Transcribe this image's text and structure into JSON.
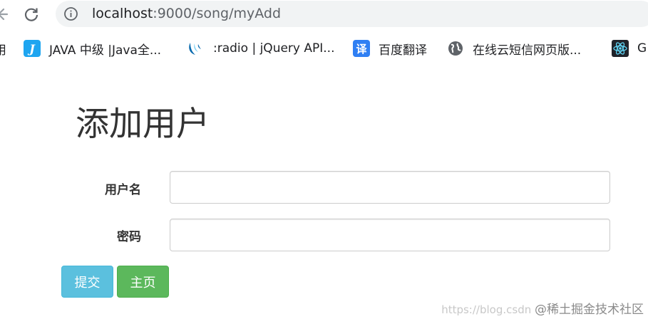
{
  "browser": {
    "url_host": "localhost",
    "url_rest": ":9000/song/myAdd",
    "icons": {
      "back": "back-arrow-icon",
      "reload": "reload-icon",
      "info": "info-icon"
    }
  },
  "bookmarks": {
    "items": [
      {
        "label": "用",
        "icon": "bookmark-icon"
      },
      {
        "label": "JAVA 中级 |Java全...",
        "icon": "java-j-icon",
        "color": "#1ea5f0"
      },
      {
        "label": ":radio | jQuery API...",
        "icon": "jquery-icon",
        "color": "#0769ad"
      },
      {
        "label": "百度翻译",
        "icon": "translate-icon",
        "color": "#2f7ff3"
      },
      {
        "label": "在线云短信网页版...",
        "icon": "globe-icon",
        "color": "#5f6368"
      },
      {
        "label": "G",
        "icon": "react-icon",
        "color": "#61dafb"
      }
    ]
  },
  "page": {
    "title": "添加用户",
    "form": {
      "username_label": "用户名",
      "username_value": "",
      "password_label": "密码",
      "password_value": ""
    },
    "buttons": {
      "submit_label": "提交",
      "home_label": "主页"
    },
    "colors": {
      "info": "#5bc0de",
      "success": "#5cb85c"
    }
  },
  "watermark": {
    "url_text": "https://blog.csdn",
    "site_text": "@稀土掘金技术社区"
  }
}
